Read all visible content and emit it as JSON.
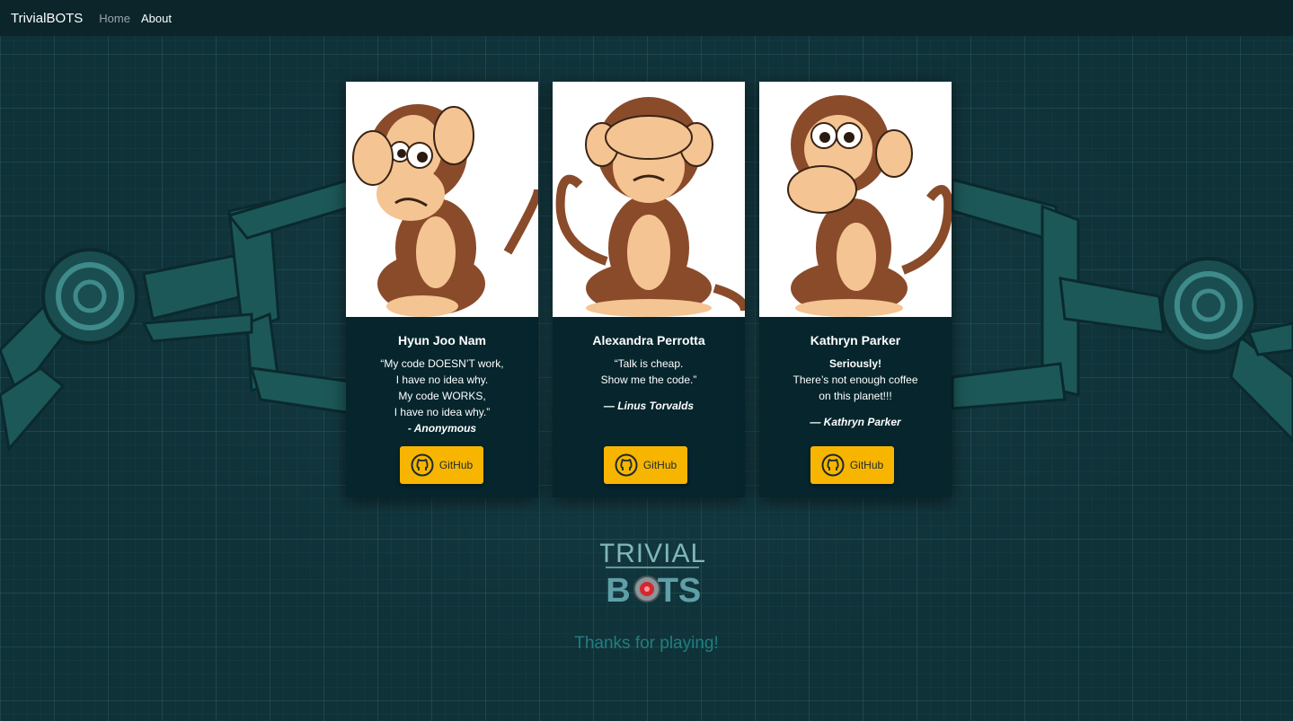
{
  "navbar": {
    "brand": "TrivialBOTS",
    "links": [
      {
        "label": "Home",
        "active": false
      },
      {
        "label": "About",
        "active": true
      }
    ]
  },
  "cards": [
    {
      "name": "Hyun Joo Nam",
      "image": "monkey-hear-no-evil",
      "quote_lines": [
        "“My code DOESN’T work,",
        "I have no idea why.",
        "My code WORKS,",
        "I have no idea why.”"
      ],
      "attribution": "- Anonymous",
      "button_label": "GitHub"
    },
    {
      "name": "Alexandra Perrotta",
      "image": "monkey-see-no-evil",
      "quote_lines": [
        "“Talk is cheap.",
        "Show me the code.”"
      ],
      "attribution": "— Linus Torvalds",
      "button_label": "GitHub"
    },
    {
      "name": "Kathryn Parker",
      "image": "monkey-speak-no-evil",
      "quote_bold": "Seriously!",
      "quote_lines": [
        "There’s not enough coffee",
        "on this planet!!!"
      ],
      "attribution": "— Kathryn Parker",
      "button_label": "GitHub"
    }
  ],
  "logo": {
    "line1": "TRIVIAL",
    "line2_pre": "B",
    "line2_post": "TS"
  },
  "thanks": "Thanks for playing!",
  "colors": {
    "accent": "#f7b500",
    "card_bg": "#06252d",
    "thanks": "#1f7f7f"
  }
}
